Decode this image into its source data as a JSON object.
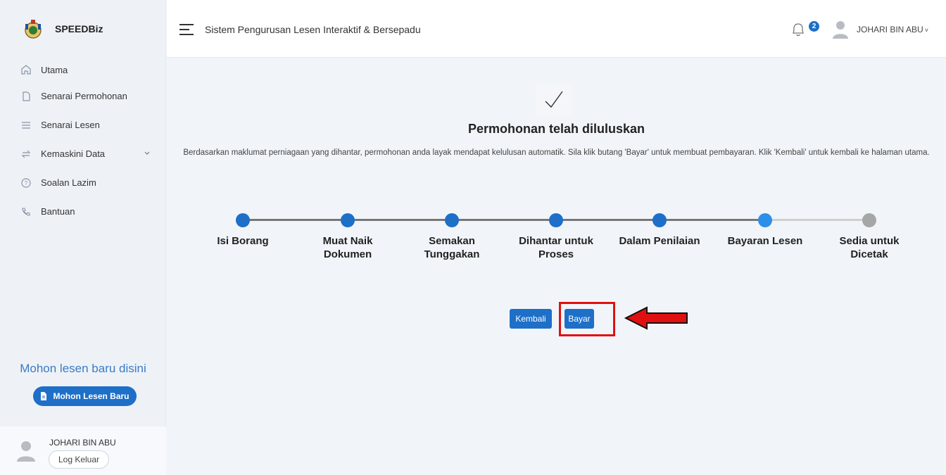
{
  "brand": {
    "name": "SPEEDBiz"
  },
  "sidebar": {
    "items": [
      {
        "label": "Utama",
        "icon": "home-icon"
      },
      {
        "label": "Senarai Permohonan",
        "icon": "document-icon"
      },
      {
        "label": "Senarai Lesen",
        "icon": "list-icon"
      },
      {
        "label": "Kemaskini Data",
        "icon": "sync-icon",
        "has_submenu": true
      },
      {
        "label": "Soalan Lazim",
        "icon": "help-icon"
      },
      {
        "label": "Bantuan",
        "icon": "phone-icon"
      }
    ],
    "cta_title": "Mohon lesen baru disini",
    "cta_button": "Mohon Lesen Baru",
    "user_name": "JOHARI BIN ABU",
    "logout_label": "Log Keluar"
  },
  "header": {
    "title": "Sistem Pengurusan Lesen Interaktif & Bersepadu",
    "notification_count": "2",
    "user_name": "JOHARI BIN ABU"
  },
  "main": {
    "title": "Permohonan telah diluluskan",
    "description": "Berdasarkan maklumat perniagaan yang dihantar, permohonan anda layak mendapat kelulusan automatik. Sila klik butang 'Bayar' untuk membuat pembayaran. Klik 'Kembali' untuk kembali ke halaman utama.",
    "steps": [
      {
        "line1": "Isi Borang",
        "line2": "",
        "status": "done"
      },
      {
        "line1": "Muat Naik",
        "line2": "Dokumen",
        "status": "done"
      },
      {
        "line1": "Semakan",
        "line2": "Tunggakan",
        "status": "done"
      },
      {
        "line1": "Dihantar untuk",
        "line2": "Proses",
        "status": "done"
      },
      {
        "line1": "Dalam Penilaian",
        "line2": "",
        "status": "done"
      },
      {
        "line1": "Bayaran Lesen",
        "line2": "",
        "status": "current"
      },
      {
        "line1": "Sedia untuk",
        "line2": "Dicetak",
        "status": "pending"
      }
    ],
    "back_button": "Kembali",
    "pay_button": "Bayar"
  },
  "colors": {
    "primary": "#1d6fc8",
    "current_step": "#2d8fe8",
    "pending_step": "#a6a6a6",
    "highlight": "#e01010"
  }
}
